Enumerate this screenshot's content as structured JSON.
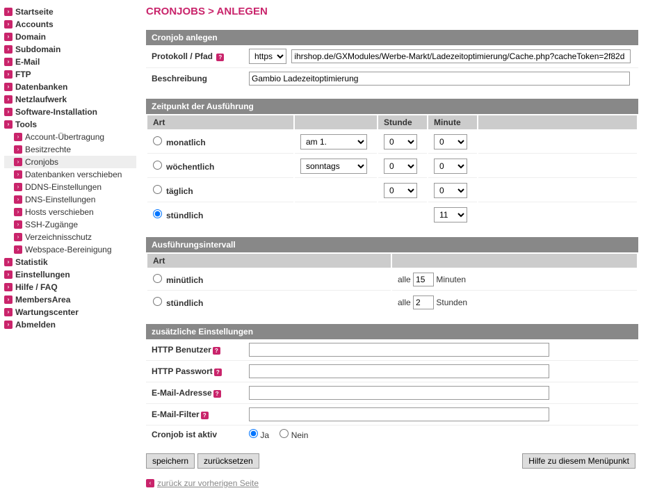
{
  "sidebar": {
    "items": [
      {
        "label": "Startseite",
        "name": "startseite",
        "sub": false
      },
      {
        "label": "Accounts",
        "name": "accounts",
        "sub": false
      },
      {
        "label": "Domain",
        "name": "domain",
        "sub": false
      },
      {
        "label": "Subdomain",
        "name": "subdomain",
        "sub": false
      },
      {
        "label": "E-Mail",
        "name": "email",
        "sub": false
      },
      {
        "label": "FTP",
        "name": "ftp",
        "sub": false
      },
      {
        "label": "Datenbanken",
        "name": "datenbanken",
        "sub": false
      },
      {
        "label": "Netzlaufwerk",
        "name": "netzlaufwerk",
        "sub": false
      },
      {
        "label": "Software-Installation",
        "name": "software",
        "sub": false
      },
      {
        "label": "Tools",
        "name": "tools",
        "sub": false
      },
      {
        "label": "Account-Übertragung",
        "name": "account-uebertragung",
        "sub": true
      },
      {
        "label": "Besitzrechte",
        "name": "besitzrechte",
        "sub": true
      },
      {
        "label": "Cronjobs",
        "name": "cronjobs",
        "sub": true,
        "active": true
      },
      {
        "label": "Datenbanken verschieben",
        "name": "db-verschieben",
        "sub": true
      },
      {
        "label": "DDNS-Einstellungen",
        "name": "ddns",
        "sub": true
      },
      {
        "label": "DNS-Einstellungen",
        "name": "dns",
        "sub": true
      },
      {
        "label": "Hosts verschieben",
        "name": "hosts",
        "sub": true
      },
      {
        "label": "SSH-Zugänge",
        "name": "ssh",
        "sub": true
      },
      {
        "label": "Verzeichnisschutz",
        "name": "verzeichnisschutz",
        "sub": true
      },
      {
        "label": "Webspace-Bereinigung",
        "name": "webspace",
        "sub": true
      },
      {
        "label": "Statistik",
        "name": "statistik",
        "sub": false
      },
      {
        "label": "Einstellungen",
        "name": "einstellungen",
        "sub": false
      },
      {
        "label": "Hilfe / FAQ",
        "name": "hilfe",
        "sub": false
      },
      {
        "label": "MembersArea",
        "name": "members",
        "sub": false
      },
      {
        "label": "Wartungscenter",
        "name": "wartung",
        "sub": false
      },
      {
        "label": "Abmelden",
        "name": "abmelden",
        "sub": false
      }
    ]
  },
  "page": {
    "title": "CRONJOBS > ANLEGEN"
  },
  "section1": {
    "header": "Cronjob anlegen",
    "protocol_label": "Protokoll / Pfad",
    "protocol_value": "https://",
    "path_value": "ihrshop.de/GXModules/Werbe-Markt/Ladezeitoptimierung/Cache.php?cacheToken=2f82d",
    "desc_label": "Beschreibung",
    "desc_value": "Gambio Ladezeitoptimierung"
  },
  "section2": {
    "header": "Zeitpunkt der Ausführung",
    "col_art": "Art",
    "col_hour": "Stunde",
    "col_min": "Minute",
    "rows": [
      {
        "label": "monatlich",
        "sel": "am 1.",
        "hour": "0",
        "min": "0"
      },
      {
        "label": "wöchentlich",
        "sel": "sonntags",
        "hour": "0",
        "min": "0"
      },
      {
        "label": "täglich",
        "hour": "0",
        "min": "0"
      },
      {
        "label": "stündlich",
        "min": "11"
      }
    ]
  },
  "section3": {
    "header": "Ausführungsintervall",
    "col_art": "Art",
    "word_alle": "alle",
    "word_minuten": "Minuten",
    "word_stunden": "Stunden",
    "rows": [
      {
        "label": "minütlich",
        "value": "15"
      },
      {
        "label": "stündlich",
        "value": "2"
      }
    ]
  },
  "section4": {
    "header": "zusätzliche Einstellungen",
    "http_user": "HTTP Benutzer",
    "http_pass": "HTTP Passwort",
    "email_addr": "E-Mail-Adresse",
    "email_filter": "E-Mail-Filter",
    "active_label": "Cronjob ist aktiv",
    "yes": "Ja",
    "no": "Nein"
  },
  "buttons": {
    "save": "speichern",
    "reset": "zurücksetzen",
    "help": "Hilfe zu diesem Menüpunkt"
  },
  "back": {
    "label": "zurück zur vorherigen Seite"
  }
}
